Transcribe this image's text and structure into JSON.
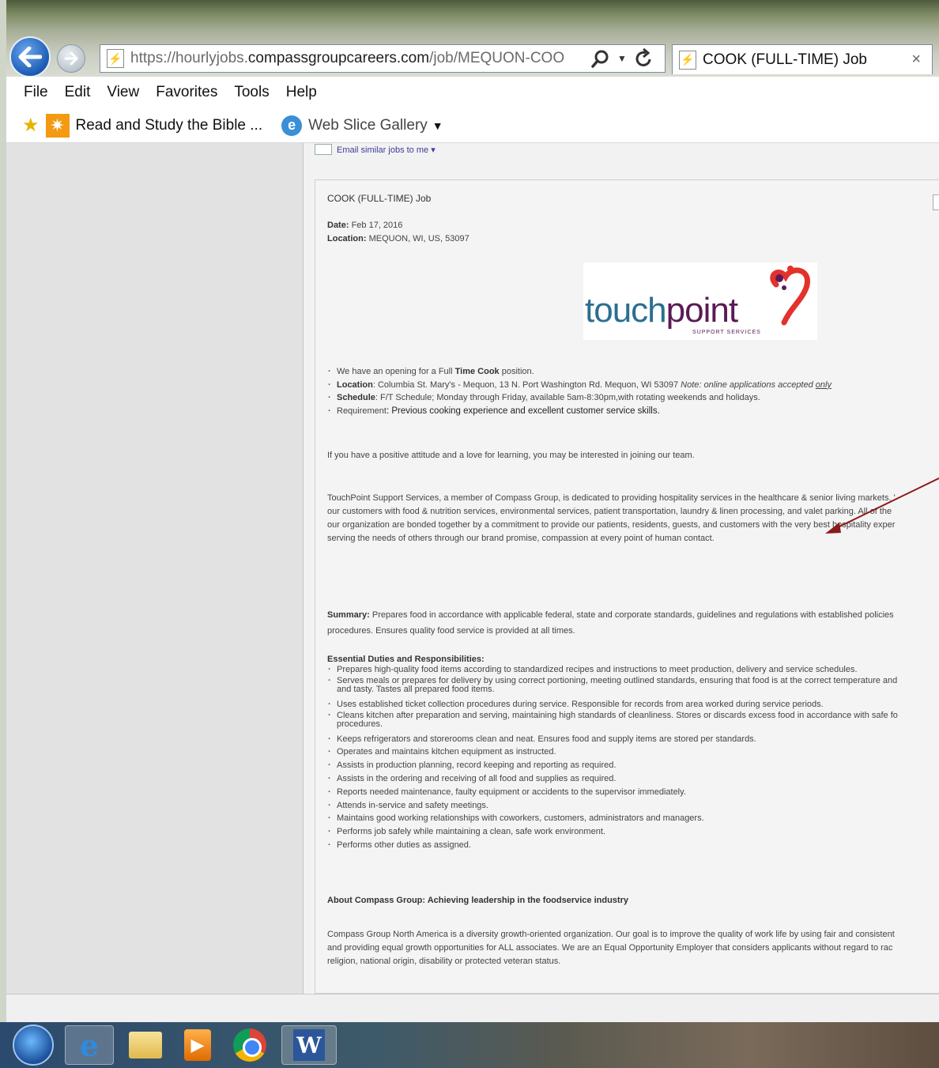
{
  "browser": {
    "url_prefix": "https://hourlyjobs.",
    "url_domain": "compassgroupcareers.com",
    "url_suffix": "/job/MEQUON-COO",
    "tab_title": "COOK (FULL-TIME) Job",
    "tab_close": "×"
  },
  "menu": [
    "File",
    "Edit",
    "View",
    "Favorites",
    "Tools",
    "Help"
  ],
  "favorites": {
    "item1": "Read and Study the Bible ...",
    "item2": "Web Slice Gallery"
  },
  "page": {
    "email_link": "Email similar jobs to me ▾",
    "job_title": "COOK (FULL-TIME) Job",
    "date_label": "Date:",
    "date_value": "Feb 17, 2016",
    "location_label": "Location:",
    "location_value": "MEQUON, WI, US, 53097",
    "logo": {
      "part1": "touch",
      "part2": "point",
      "sub": "SUPPORT SERVICES"
    },
    "intro": {
      "opening_pre": "We have an opening for a Full ",
      "opening_bold": "Time Cook",
      "opening_post": " position.",
      "location_label": "Location",
      "location_text": ": Columbia St. Mary's - Mequon, 13  N. Port Washington Rd.  Mequon, WI  53097 ",
      "location_note": "Note: online applications accepted ",
      "location_only": "only",
      "schedule_label": "Schedule",
      "schedule_text": ": F/T Schedule; Monday through Friday, available 5am-8:30pm,with rotating weekends and holidays.",
      "requirement_label": "Requirement",
      "requirement_text": ": Previous cooking experience and excellent customer service skills."
    },
    "positive": "If you have a positive attitude and a love for learning, you may be interested in joining our team.",
    "touchpoint_para": [
      "TouchPoint Support Services, a member of Compass Group, is dedicated to providing hospitality services in the healthcare & senior living markets. '",
      "our customers with food & nutrition services, environmental services, patient transportation, laundry & linen processing, and valet parking. All of the",
      "our organization are bonded together by a commitment to provide our patients, residents, guests, and customers with the very best hospitality exper",
      "serving the needs of others through our brand promise, compassion at every point of human contact."
    ],
    "summary_label": "Summary:",
    "summary_line1": " Prepares food in accordance with applicable federal, state and corporate standards, guidelines and regulations with established policies",
    "summary_line2": "procedures. Ensures quality food service is provided at all times.",
    "duties_heading": "Essential Duties and Responsibilities:",
    "duties": [
      "Prepares high-quality food items according to standardized recipes and instructions to meet production, delivery and service schedules.",
      "Serves meals or prepares for delivery by using correct portioning, meeting outlined standards, ensuring that food is at the correct temperature and",
      "Uses established ticket collection procedures during service. Responsible for records from area worked during service periods.",
      "Cleans kitchen after preparation and serving, maintaining high standards of cleanliness. Stores or discards excess food in accordance with safe fo",
      "Keeps refrigerators and storerooms clean and neat. Ensures food and supply items are stored per standards.",
      "Operates and maintains kitchen equipment as instructed.",
      "Assists in production planning, record keeping and reporting as required.",
      "Assists in the ordering and receiving of all food and supplies as required.",
      "Reports needed maintenance, faulty equipment or accidents to the supervisor immediately.",
      "Attends in-service and safety meetings.",
      "Maintains good working relationships with coworkers, customers, administrators and managers.",
      "Performs job safely while maintaining a clean, safe work environment.",
      "Performs other duties as assigned."
    ],
    "duty2_cont": "and tasty. Tastes all prepared food items.",
    "duty4_cont": "procedures.",
    "about_heading": "About Compass Group: Achieving leadership in the foodservice industry",
    "compass_para": [
      "Compass Group North America is a diversity growth-oriented organization. Our goal is to improve the quality of work life by using fair and consistent",
      "and providing equal growth opportunities for ALL associates. We are an Equal Opportunity Employer that considers applicants without regard to rac",
      "religion, national origin, disability or protected veteran status."
    ]
  },
  "taskbar": {
    "media_glyph": "▶",
    "word_glyph": "W",
    "ie_glyph": "e"
  },
  "colors": {
    "logo_teal": "#2a6f8f",
    "logo_plum": "#5b1a55",
    "arrow": "#8b1a1a"
  }
}
